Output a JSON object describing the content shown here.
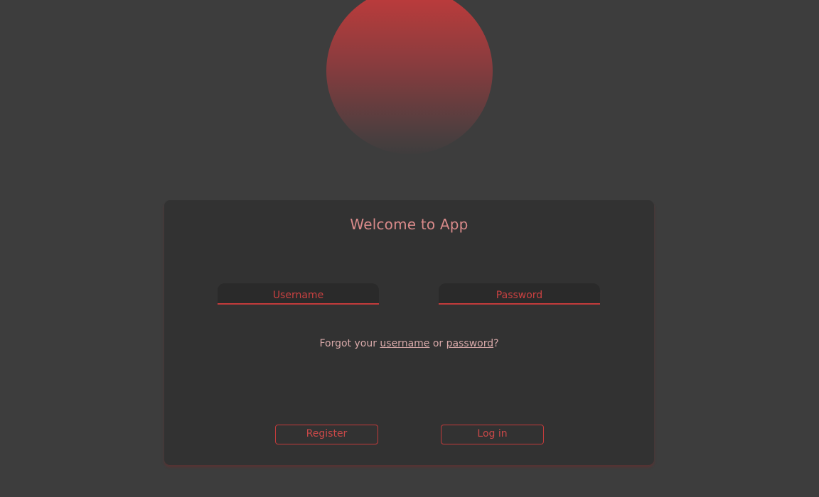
{
  "app": {
    "title": "Welcome to App"
  },
  "login": {
    "username_placeholder": "Username",
    "username_value": "",
    "password_placeholder": "Password",
    "password_value": "",
    "forgot_prefix": "Forgot your ",
    "forgot_username_link": "username",
    "forgot_or": " or ",
    "forgot_password_link": "password",
    "forgot_suffix": "?",
    "register_label": "Register",
    "login_label": "Log in"
  },
  "colors": {
    "background": "#3d3d3d",
    "card": "#323232",
    "accent": "#c23b3b",
    "title_text": "#d98a8a",
    "link_text": "#d8a9a9"
  }
}
